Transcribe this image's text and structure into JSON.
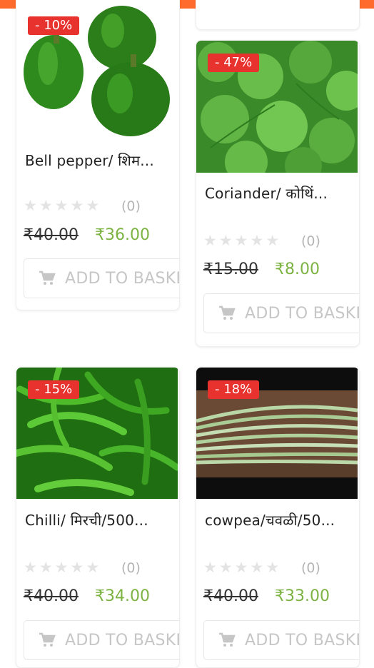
{
  "app": {
    "accent_color": "#ff6b2c",
    "badge_color": "#e8322e",
    "price_color": "#7cb342"
  },
  "products": [
    {
      "name": "Bell pepper/ शिम...",
      "discount": "- 10%",
      "rating_count": "(0)",
      "old_price": "₹40.00",
      "new_price": "₹36.00",
      "button_label": "ADD TO BASKET",
      "image": "green-bell-peppers"
    },
    {
      "name": "Coriander/ कोथिं...",
      "discount": "- 47%",
      "rating_count": "(0)",
      "old_price": "₹15.00",
      "new_price": "₹8.00",
      "button_label": "ADD TO BASKET",
      "image": "coriander-leaves"
    },
    {
      "name": "Chilli/ मिरची/500...",
      "discount": "- 15%",
      "rating_count": "(0)",
      "old_price": "₹40.00",
      "new_price": "₹34.00",
      "button_label": "ADD TO BASKET",
      "image": "green-chillies"
    },
    {
      "name": "cowpea/चवळी/50...",
      "discount": "- 18%",
      "rating_count": "(0)",
      "old_price": "₹40.00",
      "new_price": "₹33.00",
      "button_label": "ADD TO BASKET",
      "image": "cowpea-beans"
    }
  ],
  "icons": {
    "star": "star-icon",
    "cart": "cart-icon"
  }
}
